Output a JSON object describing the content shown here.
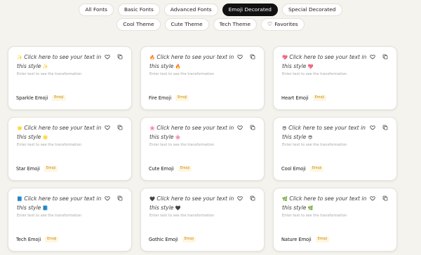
{
  "tabs": [
    {
      "label": "All Fonts",
      "active": false
    },
    {
      "label": "Basic Fonts",
      "active": false
    },
    {
      "label": "Advanced Fonts",
      "active": false
    },
    {
      "label": "Emoji Decorated",
      "active": true
    },
    {
      "label": "Special Decorated",
      "active": false
    }
  ],
  "themes": [
    {
      "label": "Cool Theme"
    },
    {
      "label": "Cute Theme"
    },
    {
      "label": "Tech Theme"
    }
  ],
  "favorites_label": "Favorites",
  "preview_text": "Click here to see your text in this style",
  "hint_text": "Enter text to see the transformation",
  "cards": [
    {
      "name": "Sparkle Emoji",
      "badge": "Emoji",
      "emoji": "✨"
    },
    {
      "name": "Fire Emoji",
      "badge": "Emoji",
      "emoji": "🔥"
    },
    {
      "name": "Heart Emoji",
      "badge": "Emoji",
      "emoji": "💖"
    },
    {
      "name": "Star Emoji",
      "badge": "Emoji",
      "emoji": "🌟"
    },
    {
      "name": "Cute Emoji",
      "badge": "Emoji",
      "emoji": "🌸"
    },
    {
      "name": "Cool Emoji",
      "badge": "Emoji",
      "emoji": "😎"
    },
    {
      "name": "Tech Emoji",
      "badge": "Emoji",
      "emoji": "📘"
    },
    {
      "name": "Gothic Emoji",
      "badge": "Emoji",
      "emoji": "🖤"
    },
    {
      "name": "Nature Emoji",
      "badge": "Emoji",
      "emoji": "🌿"
    }
  ],
  "colors": {
    "active_tab": "#111111",
    "badge_text": "#c4870e",
    "badge_bg": "#fff6df",
    "page_bg": "#f4f3ee"
  }
}
